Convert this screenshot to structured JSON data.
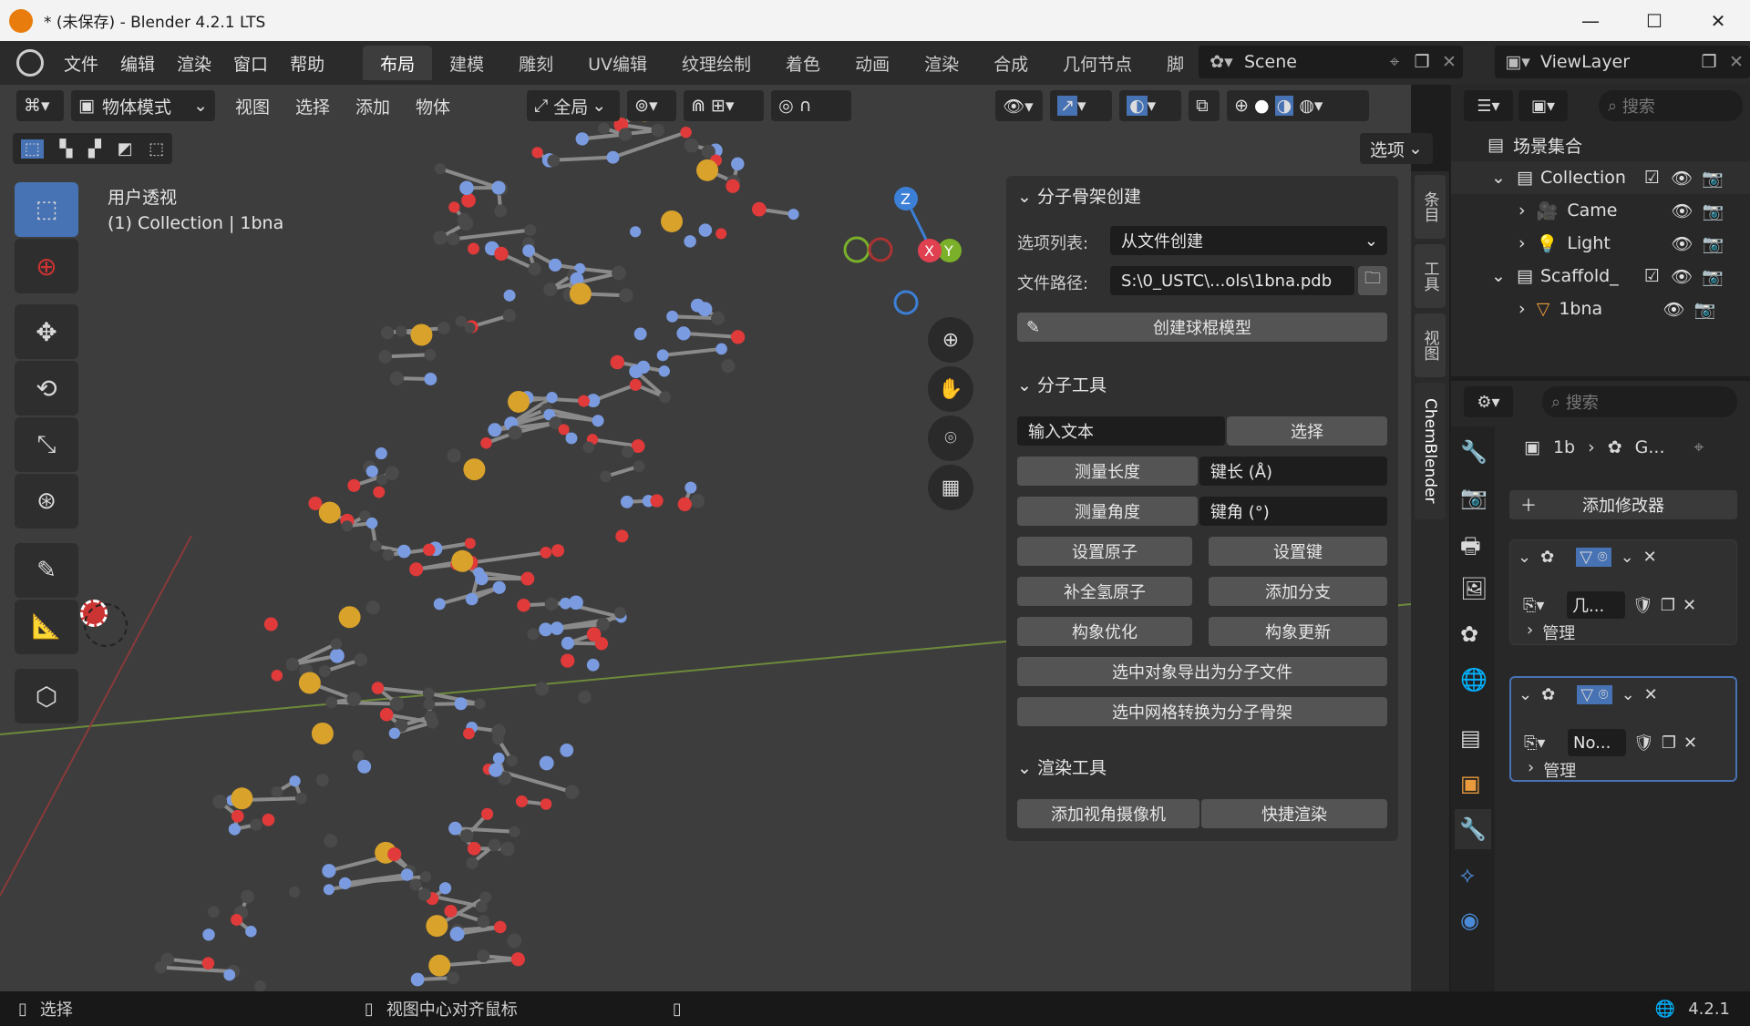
{
  "window": {
    "title": "* (未保存) - Blender 4.2.1 LTS",
    "minimize": "—",
    "maximize": "☐",
    "close": "✕"
  },
  "menu": {
    "items": [
      "文件",
      "编辑",
      "渲染",
      "窗口",
      "帮助"
    ]
  },
  "workspaces": {
    "active": "布局",
    "tabs": [
      "布局",
      "建模",
      "雕刻",
      "UV编辑",
      "纹理绘制",
      "着色",
      "动画",
      "渲染",
      "合成",
      "几何节点",
      "脚"
    ]
  },
  "scene": {
    "name": "Scene"
  },
  "view_layer": {
    "name": "ViewLayer"
  },
  "viewport_header": {
    "mode": "物体模式",
    "menus": [
      "视图",
      "选择",
      "添加",
      "物体"
    ],
    "transform": "全局",
    "options": "选项"
  },
  "viewport": {
    "view_name": "用户透视",
    "info": "(1) Collection | 1bna",
    "axis": {
      "x": "X",
      "y": "Y",
      "z": "Z"
    }
  },
  "side_tabs": [
    "条目",
    "工具",
    "视图",
    "ChemBlender"
  ],
  "panel": {
    "skeleton": {
      "title": "分子骨架创建",
      "list_label": "选项列表:",
      "list_value": "从文件创建",
      "path_label": "文件路径:",
      "path_value": "S:\\0_USTC\\...ols\\1bna.pdb",
      "create_button": "创建球棍模型"
    },
    "tools": {
      "title": "分子工具",
      "input_text": "输入文本",
      "select": "选择",
      "measure_length": "测量长度",
      "bond_length": "键长 (Å)",
      "measure_angle": "测量角度",
      "bond_angle": "键角 (°)",
      "set_atom": "设置原子",
      "set_bond": "设置键",
      "add_h": "补全氢原子",
      "add_branch": "添加分支",
      "optimize": "构象优化",
      "update": "构象更新",
      "export": "选中对象导出为分子文件",
      "convert": "选中网格转换为分子骨架"
    },
    "render": {
      "title": "渲染工具",
      "add_camera": "添加视角摄像机",
      "quick_render": "快捷渲染"
    }
  },
  "outliner": {
    "search_placeholder": "搜索",
    "root": "场景集合",
    "rows": [
      {
        "label": "Collection"
      },
      {
        "label": "Came"
      },
      {
        "label": "Light"
      },
      {
        "label": "Scaffold_"
      },
      {
        "label": "1bna"
      }
    ]
  },
  "properties": {
    "search_placeholder": "搜索",
    "breadcrumb": [
      "1b",
      "G..."
    ],
    "add_modifier": "添加修改器",
    "modifiers": [
      {
        "field": "几...",
        "manage": "管理"
      },
      {
        "field": "No...",
        "manage": "管理"
      }
    ]
  },
  "status": {
    "left": "选择",
    "middle": "视图中心对齐鼠标",
    "version": "4.2.1"
  },
  "colors": {
    "accent": "#4772b3",
    "viewport": "#3d3d3d",
    "panel": "#303030",
    "atom_o": "#e03a3a",
    "atom_n": "#7a9be0",
    "atom_p": "#d9a22b",
    "atom_c": "#4a4a4a"
  }
}
